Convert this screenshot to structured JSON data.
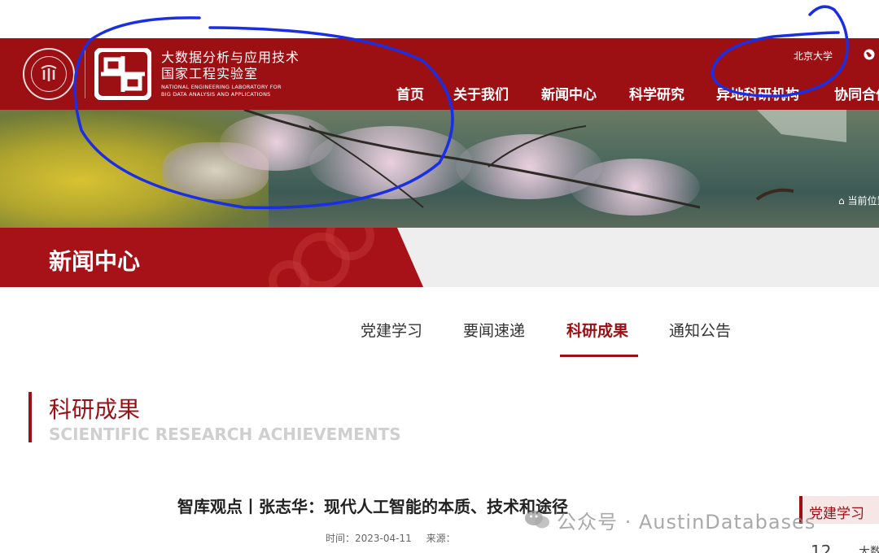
{
  "header": {
    "lab_name_cn_line1": "大数据分析与应用技术",
    "lab_name_cn_line2": "国家工程实验室",
    "lab_name_en_line1": "NATIONAL ENGINEERING LABORATORY FOR",
    "lab_name_en_line2": "BIG DATA ANALYSIS AND APPLICATIONS",
    "util_link": "北京大学",
    "globe_icon": "globe-icon",
    "seal_icon": "pku-seal-icon",
    "brand_color": "#9c0f12"
  },
  "nav": {
    "items": [
      {
        "label": "首页"
      },
      {
        "label": "关于我们"
      },
      {
        "label": "新闻中心"
      },
      {
        "label": "科学研究"
      },
      {
        "label": "异地科研机构"
      },
      {
        "label": "协同合作"
      }
    ]
  },
  "banner": {
    "breadcrumb": "当前位置"
  },
  "section": {
    "title": "新闻中心"
  },
  "subnav": {
    "items": [
      {
        "label": "党建学习"
      },
      {
        "label": "要闻速递"
      },
      {
        "label": "科研成果",
        "active": true
      },
      {
        "label": "通知公告"
      }
    ]
  },
  "page": {
    "heading_cn": "科研成果",
    "heading_en": "SCIENTIFIC RESEARCH ACHIEVEMENTS"
  },
  "article": {
    "title": "智库观点丨张志华：现代人工智能的本质、技术和途径",
    "time_label": "时间：2023-04-11",
    "source_label": "来源："
  },
  "sidebar": {
    "tab_label": "党建学习",
    "item_number": "12",
    "item_text": "大数"
  },
  "watermark": {
    "text": "公众号 · AustinDatabases",
    "icon": "wechat-icon"
  },
  "annotation": {
    "color": "#1a2ee6"
  }
}
